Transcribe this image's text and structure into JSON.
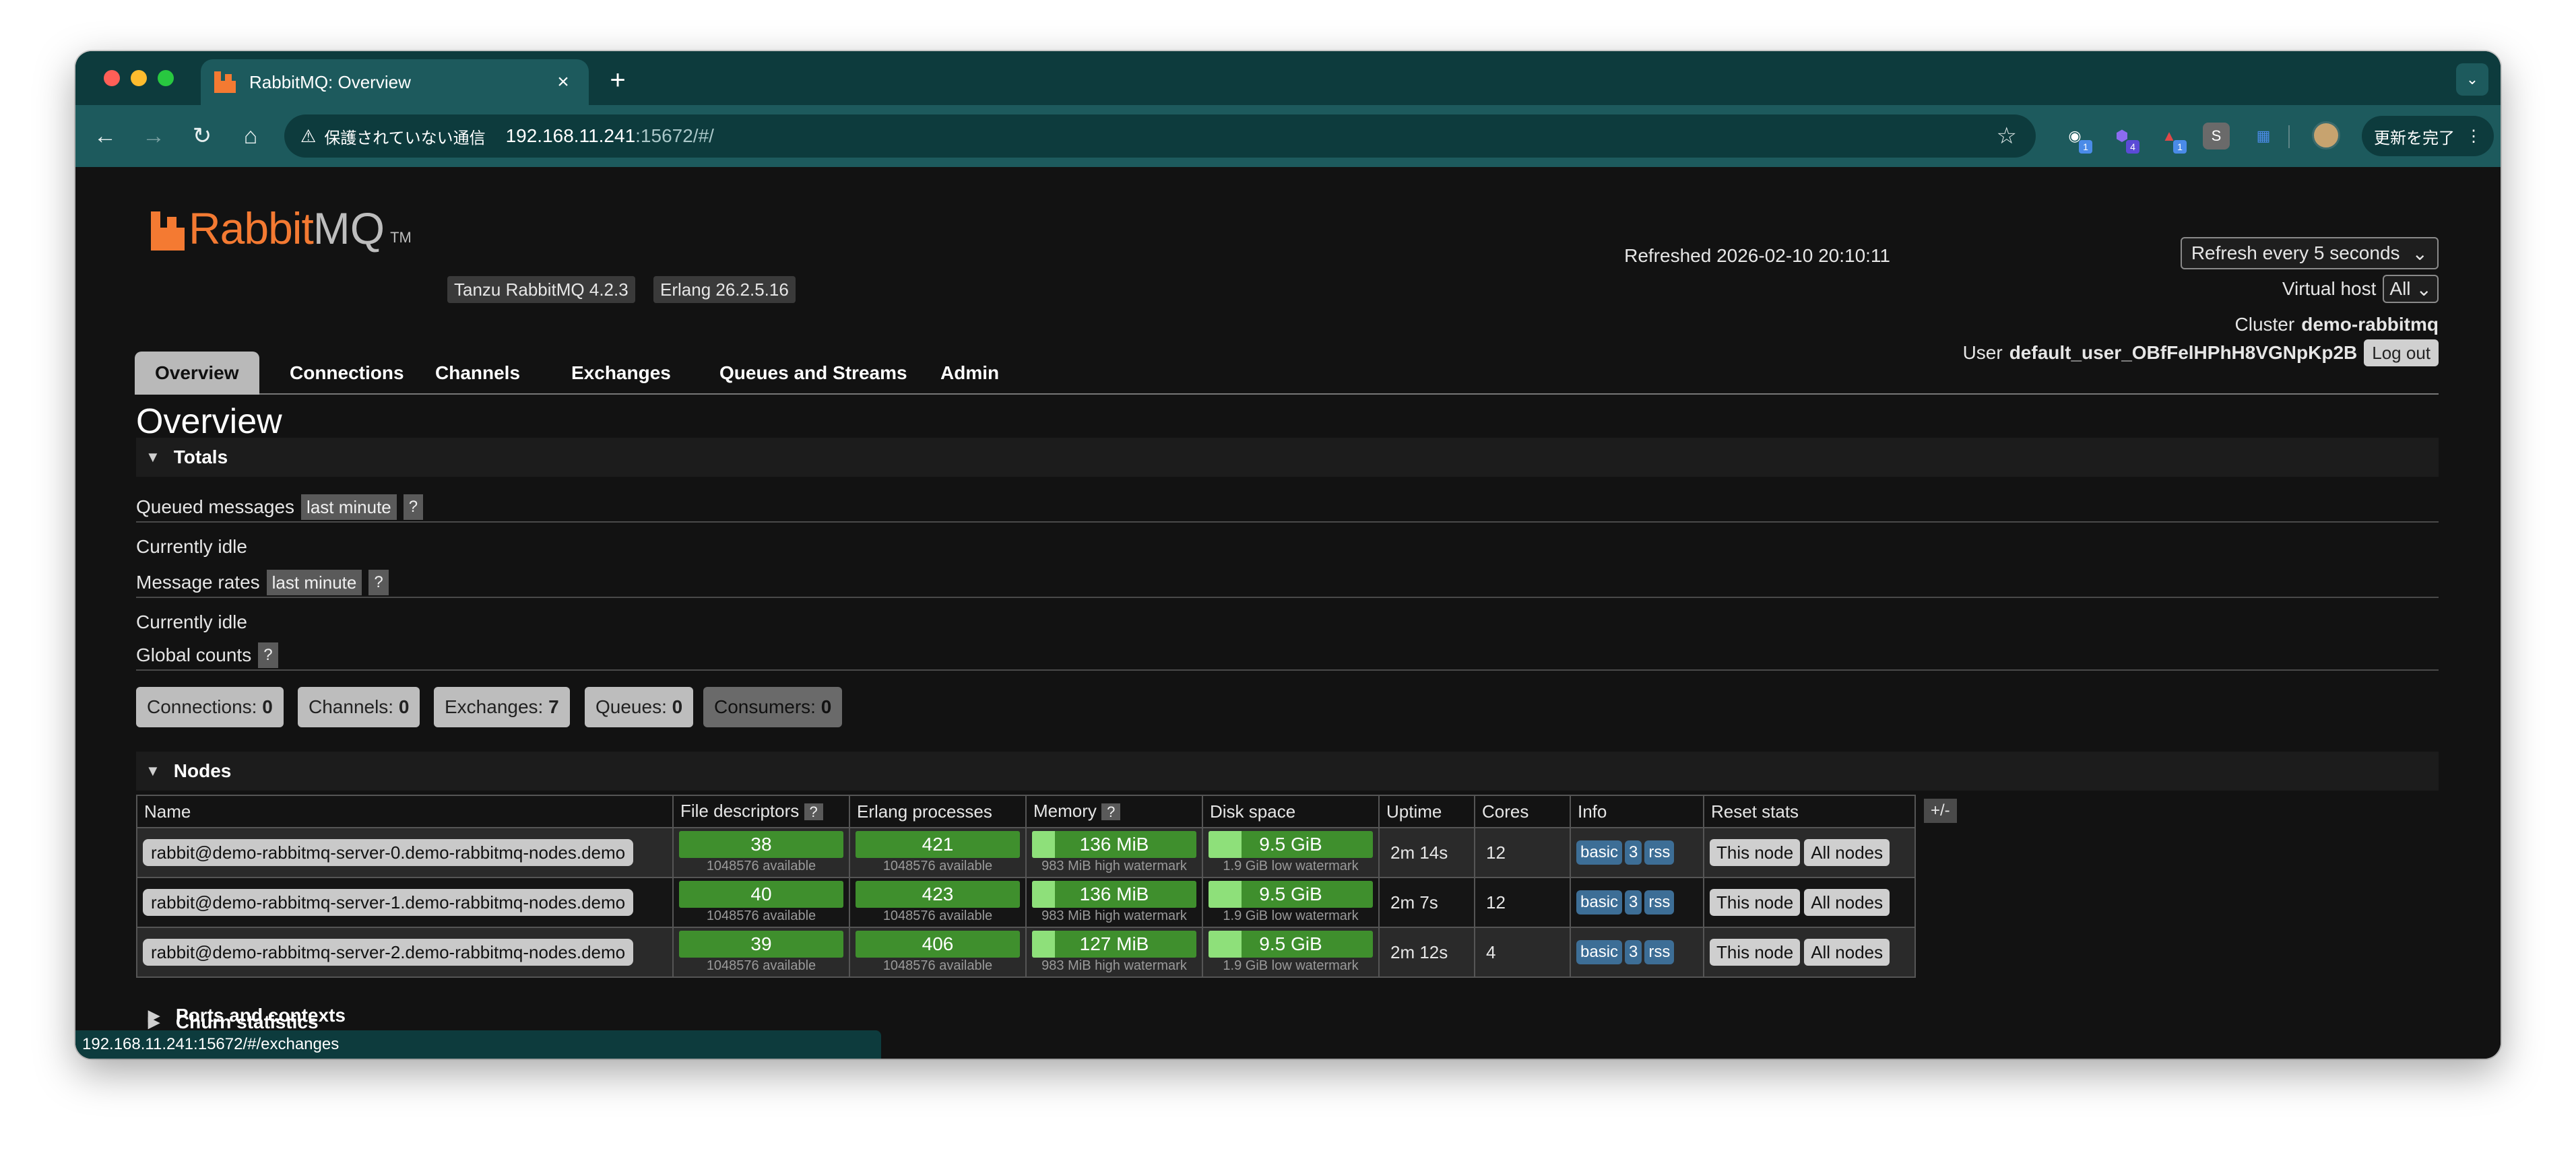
{
  "browser": {
    "tab_title": "RabbitMQ: Overview",
    "tab_close": "×",
    "new_tab": "+",
    "tab_search": "⌄",
    "nav_back": "←",
    "nav_forward": "→",
    "nav_reload": "↻",
    "nav_home": "⌂",
    "insecure_label": "保護されていない通信",
    "url_host": "192.168.11.241",
    "url_rest": ":15672/#/",
    "bookmark_star": "☆",
    "ext_badges": [
      "1",
      "4",
      "1"
    ],
    "ext_s": "S",
    "update_label": "更新を完了",
    "menu_dots": "⋮",
    "status_url": "192.168.11.241:15672/#/exchanges"
  },
  "header": {
    "logo_rabbit": "Rabbit",
    "logo_mq": "MQ",
    "logo_tm": "TM",
    "product_version": "Tanzu RabbitMQ 4.2.3",
    "erlang_version": "Erlang 26.2.5.16",
    "refreshed": "Refreshed 2026-02-10 20:10:11",
    "refresh_select": "Refresh every 5 seconds",
    "vhost_label": "Virtual host",
    "vhost_value": "All",
    "cluster_label": "Cluster",
    "cluster_name": "demo-rabbitmq",
    "user_label": "User",
    "user_name": "default_user_OBfFelHPhH8VGNpKp2B",
    "logout": "Log out"
  },
  "nav": {
    "tabs": [
      "Overview",
      "Connections",
      "Channels",
      "Exchanges",
      "Queues and Streams",
      "Admin"
    ]
  },
  "overview": {
    "title": "Overview",
    "totals_head": "Totals",
    "queued_label": "Queued messages",
    "last_minute": "last minute",
    "qmark": "?",
    "idle": "Currently idle",
    "rates_label": "Message rates",
    "global_label": "Global counts",
    "counts": [
      {
        "label": "Connections:",
        "value": "0"
      },
      {
        "label": "Channels:",
        "value": "0"
      },
      {
        "label": "Exchanges:",
        "value": "7"
      },
      {
        "label": "Queues:",
        "value": "0"
      },
      {
        "label": "Consumers:",
        "value": "0"
      }
    ]
  },
  "nodes": {
    "head": "Nodes",
    "plusminus": "+/-",
    "columns": [
      "Name",
      "File descriptors",
      "Erlang processes",
      "Memory",
      "Disk space",
      "Uptime",
      "Cores",
      "Info",
      "Reset stats"
    ],
    "fd_available": "1048576 available",
    "proc_available": "1048576 available",
    "mem_watermark": "983 MiB high watermark",
    "disk_watermark": "1.9 GiB low watermark",
    "info_basic": "basic",
    "info_num": "3",
    "info_rss": "rss",
    "this_node": "This node",
    "all_nodes": "All nodes",
    "rows": [
      {
        "name": "rabbit@demo-rabbitmq-server-0.demo-rabbitmq-nodes.demo",
        "fd": "38",
        "proc": "421",
        "mem": "136 MiB",
        "disk": "9.5 GiB",
        "uptime": "2m 14s",
        "cores": "12"
      },
      {
        "name": "rabbit@demo-rabbitmq-server-1.demo-rabbitmq-nodes.demo",
        "fd": "40",
        "proc": "423",
        "mem": "136 MiB",
        "disk": "9.5 GiB",
        "uptime": "2m 7s",
        "cores": "12"
      },
      {
        "name": "rabbit@demo-rabbitmq-server-2.demo-rabbitmq-nodes.demo",
        "fd": "39",
        "proc": "406",
        "mem": "127 MiB",
        "disk": "9.5 GiB",
        "uptime": "2m 12s",
        "cores": "4"
      }
    ]
  },
  "sections": {
    "churn": "Churn statistics",
    "ports": "Ports and contexts"
  },
  "colors": {
    "accent": "#f47a32",
    "bar_green": "#3f8f2d",
    "bar_light": "#8ee07a",
    "chrome_teal": "#1d5a5d"
  }
}
